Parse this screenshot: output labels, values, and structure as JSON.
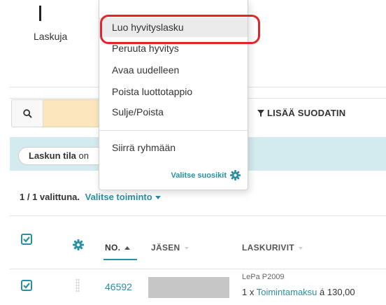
{
  "header_card": {
    "label": "Laskuja"
  },
  "toolbar": {
    "add_filter_label": "LISÄÄ SUODATIN"
  },
  "filter_chip": {
    "key": "Laskun tila",
    "rest": " on"
  },
  "selection": {
    "count_text": "1 / 1 valittuna.",
    "action_label": "Valitse toiminto"
  },
  "columns": {
    "number": "NO.",
    "member": "JÄSEN",
    "invoice_rows": "LASKURIVIT"
  },
  "row": {
    "number": "46592",
    "item_code": "LePa P2009",
    "item_prefix": "1 x ",
    "item_name": "Toimintamaksu",
    "item_price": " á 130,00"
  },
  "menu": {
    "items": [
      {
        "label": "Luo hyvityslasku"
      },
      {
        "label": "Peruuta hyvitys"
      },
      {
        "label": "Avaa uudelleen"
      },
      {
        "label": "Poista luottotappio"
      },
      {
        "label": "Sulje/Poista"
      },
      {
        "label": "Siirrä ryhmään"
      }
    ],
    "favorites_label": "Valitse suosikit"
  },
  "colors": {
    "accent": "#2a8fa3",
    "highlight": "#e3242b",
    "search_field": "#fbe6bd",
    "filter_band": "#d3ebef"
  },
  "icons": {
    "search": "search-icon",
    "filter": "filter-icon",
    "gear": "gear-icon",
    "checkbox": "checkbox-checked-icon"
  }
}
